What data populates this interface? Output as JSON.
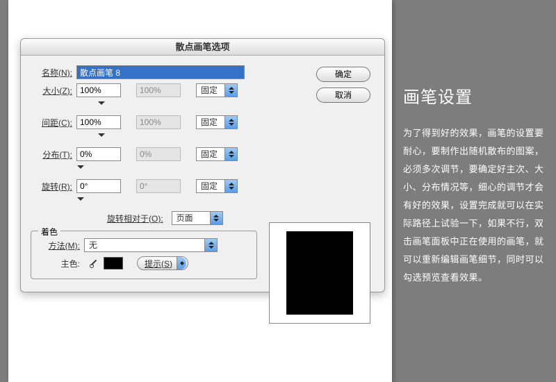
{
  "dialog": {
    "title": "散点画笔选项",
    "name_label": "名称(N):",
    "name_value": "散点画笔 8",
    "size_label": "大小(Z):",
    "size_v1": "100%",
    "size_v2": "100%",
    "size_mode": "固定",
    "spacing_label": "间距(C):",
    "spacing_v1": "100%",
    "spacing_v2": "100%",
    "spacing_mode": "固定",
    "scatter_label": "分布(T):",
    "scatter_v1": "0%",
    "scatter_v2": "0%",
    "scatter_mode": "固定",
    "rotate_label": "旋转(R):",
    "rotate_v1": "0°",
    "rotate_v2": "0°",
    "rotate_mode": "固定",
    "rotrel_label": "旋转相对于(O):",
    "rotrel_value": "页面",
    "ok": "确定",
    "cancel": "取消",
    "tint_group": "着色",
    "method_label": "方法(M):",
    "method_value": "无",
    "keycolor_label": "主色:",
    "tips": "提示(S)"
  },
  "side": {
    "heading": "画笔设置",
    "body": "为了得到好的效果，画笔的设置要耐心，要制作出随机散布的图案，必须多次调节，要确定好主次、大小、分布情况等，细心的调节才会有好的效果，设置完成就可以在实际路径上试验一下，如果不行，双击画笔面板中正在使用的画笔，就可以重新编辑画笔细节，同时可以勾选预览查看效果。"
  }
}
